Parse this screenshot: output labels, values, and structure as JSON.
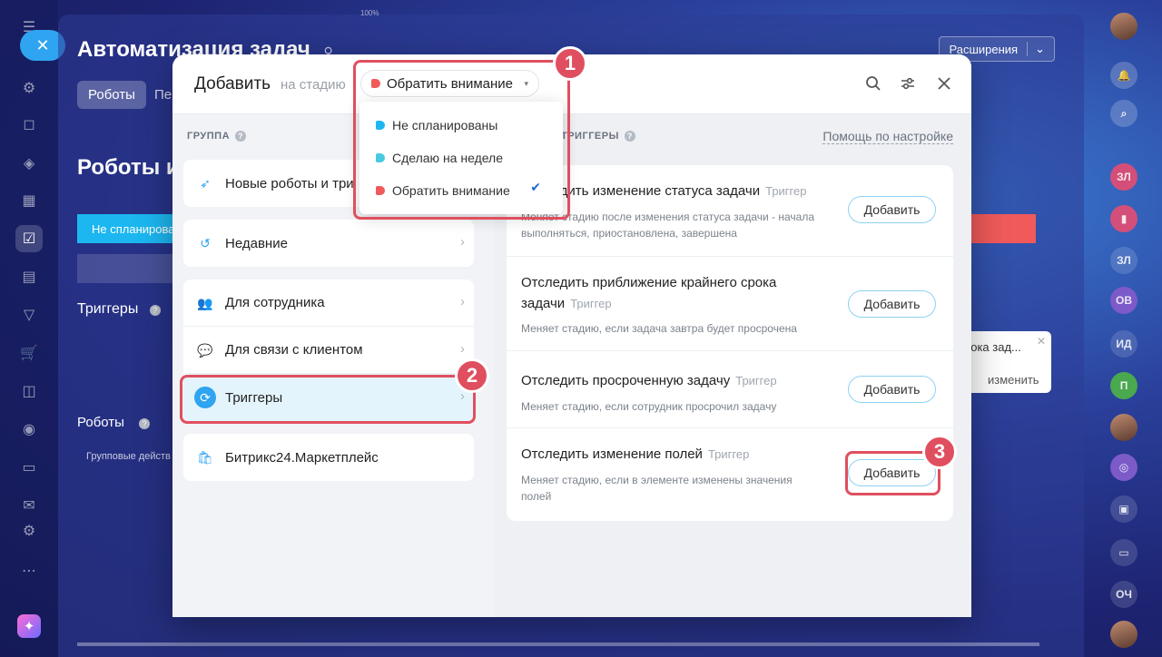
{
  "background_page": {
    "title": "Автоматизация задач",
    "pin_icon": "pin-icon",
    "tabs": [
      "Роботы",
      "Пе"
    ],
    "extensions_button": "Расширения",
    "section_title": "Роботы и",
    "stage_active": "Не спланирова",
    "triggers_label": "Триггеры",
    "robots_label": "Роботы",
    "group_actions": "Групповые действ",
    "notice": {
      "text": "рока зад...",
      "link": "изменить"
    },
    "zoom": "100%"
  },
  "modal": {
    "title": "Добавить",
    "stage_label": "на стадию",
    "stage_selected": "Обратить внимание",
    "stage_options": [
      {
        "label": "Не спланированы",
        "color": "#1cb7f0"
      },
      {
        "label": "Сделаю на неделе",
        "color": "#47cbe0"
      },
      {
        "label": "Обратить внимание",
        "color": "#f05a5a",
        "checked": true
      }
    ],
    "group_label": "ГРУППА",
    "triggers_label": "ТРИГГЕРЫ",
    "help_link": "Помощь по настройке",
    "groups": [
      {
        "label": "Новые роботы и три",
        "icon": "rocket-icon"
      },
      {
        "label": "Недавние",
        "icon": "history-icon"
      },
      {
        "label": "Для сотрудника",
        "icon": "users-icon"
      },
      {
        "label": "Для связи с клиентом",
        "icon": "chat-icon"
      },
      {
        "label": "Триггеры",
        "icon": "trigger-icon"
      },
      {
        "label": "Битрикс24.Маркетплейс",
        "icon": "market-icon"
      }
    ],
    "triggers": [
      {
        "name": "Отследить изменение статуса задачи",
        "tag": "Триггер",
        "desc": "Меняет стадию после изменения статуса задачи - начала выполняться, приостановлена, завершена",
        "button": "Добавить"
      },
      {
        "name": "Отследить приближение крайнего срока задачи",
        "tag": "Триггер",
        "desc": "Меняет стадию, если задача завтра будет просрочена",
        "button": "Добавить"
      },
      {
        "name": "Отследить просроченную задачу",
        "tag": "Триггер",
        "desc": "Меняет стадию, если сотрудник просрочил задачу",
        "button": "Добавить"
      },
      {
        "name": "Отследить изменение полей",
        "tag": "Триггер",
        "desc": "Меняет стадию, если в элементе изменены значения полей",
        "button": "Добавить"
      }
    ]
  },
  "callouts": [
    "1",
    "2",
    "3"
  ],
  "right_rail": [
    "ЗЛ",
    "ЗЛ",
    "ОВ",
    "ИД",
    "П",
    "ОЧ"
  ],
  "colors": {
    "accent": "#2fa4f1",
    "callout": "#e04f5f"
  }
}
